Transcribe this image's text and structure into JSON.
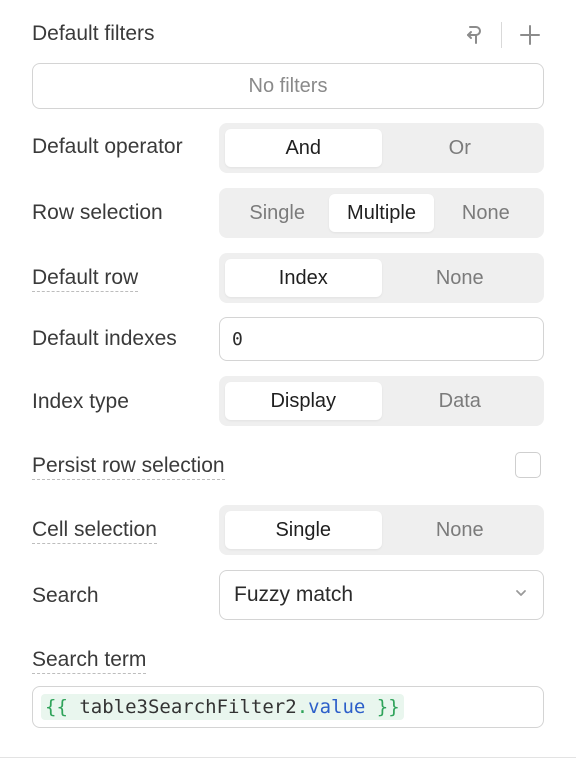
{
  "default_filters": {
    "title": "Default filters",
    "empty_text": "No filters"
  },
  "default_operator": {
    "label": "Default operator",
    "options": [
      "And",
      "Or"
    ],
    "selected": "And"
  },
  "row_selection": {
    "label": "Row selection",
    "options": [
      "Single",
      "Multiple",
      "None"
    ],
    "selected": "Multiple"
  },
  "default_row": {
    "label": "Default row",
    "options": [
      "Index",
      "None"
    ],
    "selected": "Index"
  },
  "default_indexes": {
    "label": "Default indexes",
    "value": "0"
  },
  "index_type": {
    "label": "Index type",
    "options": [
      "Display",
      "Data"
    ],
    "selected": "Display"
  },
  "persist_row_selection": {
    "label": "Persist row selection",
    "checked": false
  },
  "cell_selection": {
    "label": "Cell selection",
    "options": [
      "Single",
      "None"
    ],
    "selected": "Single"
  },
  "search": {
    "label": "Search",
    "value": "Fuzzy match"
  },
  "search_term": {
    "label": "Search term",
    "open": "{{",
    "identifier": "table3SearchFilter2",
    "dot": ".",
    "property": "value",
    "close": "}}"
  },
  "icons": {
    "reset": "reset-arrow-icon",
    "add": "plus-icon",
    "dropdown": "chevron-down-icon"
  },
  "colors": {
    "segment_bg": "#efefef",
    "code_brace": "#2fa35a",
    "code_property": "#2c5fc9",
    "code_bg": "#e9f6ee"
  }
}
